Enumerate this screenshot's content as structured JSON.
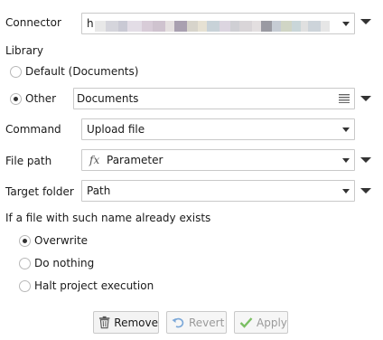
{
  "connector": {
    "label": "Connector",
    "value_prefix": "h"
  },
  "library": {
    "label": "Library",
    "options": [
      {
        "label": "Default (Documents)",
        "selected": false
      },
      {
        "label": "Other",
        "selected": true
      }
    ],
    "other_value": "Documents"
  },
  "command": {
    "label": "Command",
    "value": "Upload file"
  },
  "file_path": {
    "label": "File path",
    "fx_icon": "fx",
    "value": "Parameter"
  },
  "target_folder": {
    "label": "Target folder",
    "value": "Path"
  },
  "if_exists": {
    "label": "If a file with such name already exists",
    "options": [
      {
        "label": "Overwrite",
        "selected": true
      },
      {
        "label": "Do nothing",
        "selected": false
      },
      {
        "label": "Halt project execution",
        "selected": false
      }
    ]
  },
  "buttons": {
    "remove": "Remove",
    "revert": "Revert",
    "apply": "Apply"
  },
  "colors": {
    "apply_check": "#7bbf63",
    "revert_arrow": "#7aa7d8",
    "fx_icon": "#555555"
  }
}
